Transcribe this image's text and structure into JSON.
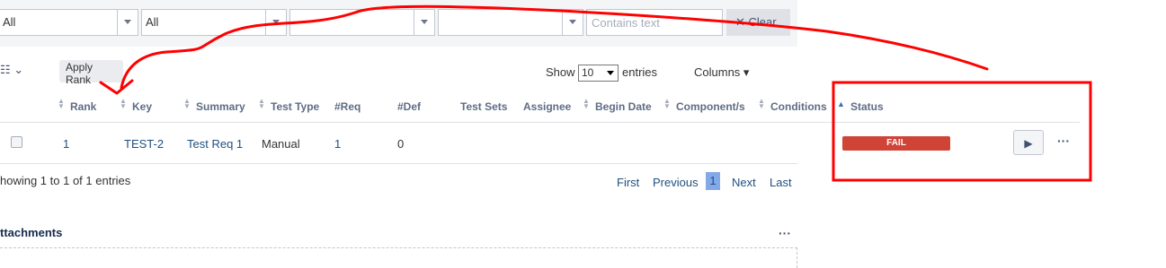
{
  "filters": {
    "select1_value": "All",
    "select2_value": "All",
    "select3_value": "",
    "select4_value": "",
    "text_placeholder": "Contains text",
    "clear_label": "✕ Clear"
  },
  "toolbar": {
    "view_icon": "☷ ⌄",
    "apply_rank_label": "Apply Rank",
    "show_label": "Show",
    "entries_value": "10",
    "entries_label": "entries",
    "columns_label": "Columns ▾"
  },
  "table": {
    "headers": [
      "Rank",
      "Key",
      "Summary",
      "Test Type",
      "#Req",
      "#Def",
      "Test Sets",
      "Assignee",
      "Begin Date",
      "Component/s",
      "Conditions",
      "Status"
    ],
    "rows": [
      {
        "rank": "1",
        "key": "TEST-2",
        "summary": "Test Req 1",
        "test_type": "Manual",
        "req": "1",
        "def": "0",
        "status": "FAIL",
        "run_icon": "▶",
        "more_icon": "···"
      }
    ]
  },
  "footer": {
    "info": "howing 1 to 1 of 1 entries",
    "pagination": {
      "first": "First",
      "previous": "Previous",
      "current": "1",
      "next": "Next",
      "last": "Last"
    }
  },
  "attachments": {
    "title": "ttachments",
    "more_icon": "···"
  },
  "colors": {
    "fail": "#d04437",
    "annotation": "#ff0000",
    "link": "#205081"
  }
}
